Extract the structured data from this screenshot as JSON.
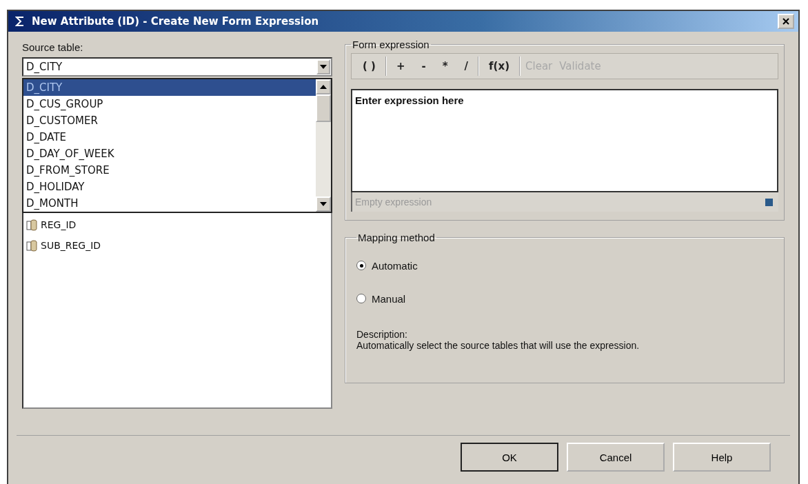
{
  "window": {
    "title": "New Attribute (ID) - Create New Form Expression"
  },
  "source_table": {
    "label": "Source table:",
    "value": "D_CITY",
    "options": [
      {
        "label": "D_CITY",
        "selected": true
      },
      {
        "label": "D_CUS_GROUP",
        "selected": false
      },
      {
        "label": "D_CUSTOMER",
        "selected": false
      },
      {
        "label": "D_DATE",
        "selected": false
      },
      {
        "label": "D_DAY_OF_WEEK",
        "selected": false
      },
      {
        "label": "D_FROM_STORE",
        "selected": false
      },
      {
        "label": "D_HOLIDAY",
        "selected": false
      },
      {
        "label": "D_MONTH",
        "selected": false
      }
    ],
    "columns": [
      "REG_ID",
      "SUB_REG_ID"
    ]
  },
  "form_expression": {
    "title": "Form expression",
    "toolbar": [
      [
        {
          "label": "( )",
          "disabled": false
        }
      ],
      [
        {
          "label": "+",
          "disabled": false
        },
        {
          "label": "-",
          "disabled": false
        },
        {
          "label": "*",
          "disabled": false
        },
        {
          "label": "/",
          "disabled": false
        }
      ],
      [
        {
          "label": "f(x)",
          "disabled": false
        }
      ],
      [
        {
          "label": "Clear",
          "disabled": true
        },
        {
          "label": "Validate",
          "disabled": true
        }
      ]
    ],
    "value": "Enter expression here",
    "status": "Empty expression"
  },
  "mapping_method": {
    "title": "Mapping method",
    "options": [
      {
        "label": "Automatic",
        "selected": true
      },
      {
        "label": "Manual",
        "selected": false
      }
    ],
    "description_label": "Description:",
    "description": "Automatically select the source tables that will use the expression."
  },
  "buttons": [
    {
      "label": "OK",
      "default": true
    },
    {
      "label": "Cancel",
      "default": false
    },
    {
      "label": "Help",
      "default": false
    }
  ]
}
